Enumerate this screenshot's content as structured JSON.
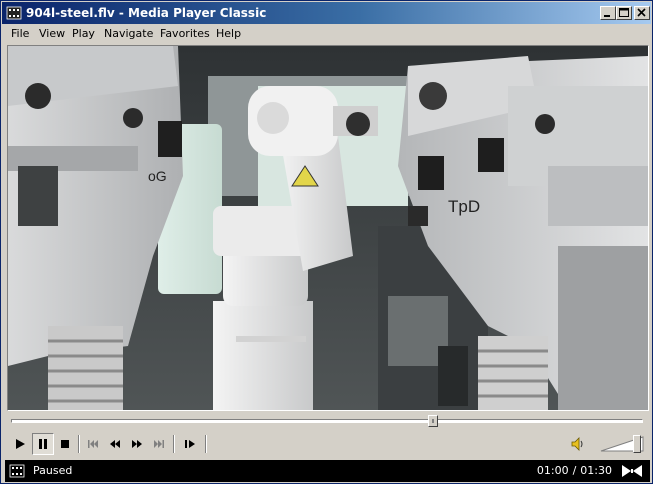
{
  "window": {
    "title": "904l-steel.flv - Media Player Classic",
    "controls": [
      "minimize",
      "maximize",
      "close"
    ]
  },
  "menu": {
    "items": [
      "File",
      "View",
      "Play",
      "Navigate",
      "Favorites",
      "Help"
    ]
  },
  "video": {
    "labels": [
      "TpD",
      "oG"
    ]
  },
  "seek": {
    "position_fraction": 0.67
  },
  "volume": {
    "level_fraction": 0.9
  },
  "status": {
    "state": "Paused",
    "current_time": "01:00",
    "separator": "/",
    "total_time": "01:30"
  },
  "colors": {
    "title_gradient_start": "#0a246a",
    "title_gradient_end": "#a6caf0",
    "chrome": "#d4d0c8",
    "statusbar_bg": "#000000"
  },
  "icons": {
    "app": "film-icon",
    "play": "play-icon",
    "pause": "pause-icon",
    "stop": "stop-icon",
    "prev": "skip-back-icon",
    "rewind": "rewind-icon",
    "forward": "fast-forward-icon",
    "next": "skip-forward-icon",
    "frame_step": "frame-step-icon",
    "volume": "speaker-icon"
  }
}
